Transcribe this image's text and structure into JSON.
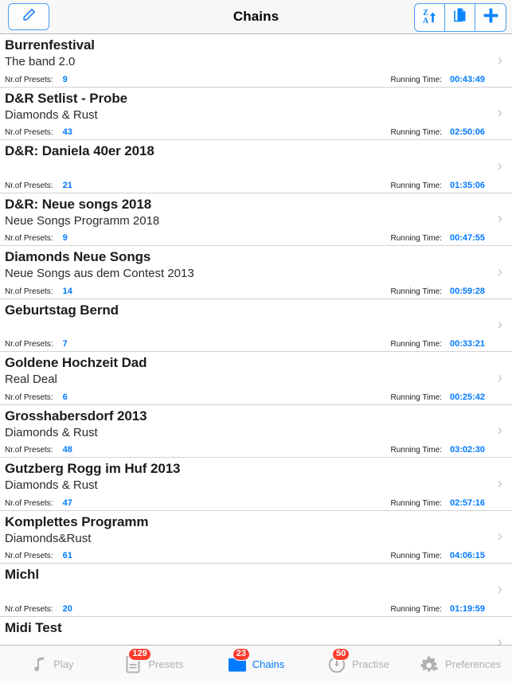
{
  "navbar": {
    "title": "Chains",
    "edit_icon": "pencil-icon",
    "sort_letters_top": "Z",
    "sort_letters_bottom": "A",
    "sort_arrow": "▲",
    "copy_icon": "duplicate-document-icon",
    "add_icon": "plus-icon"
  },
  "list": {
    "presets_label": "Nr.of Presets:",
    "time_label": "Running Time:",
    "rows": [
      {
        "title": "Burrenfestival",
        "subtitle": "The band 2.0",
        "presets": "9",
        "time": "00:43:49"
      },
      {
        "title": "D&R Setlist - Probe",
        "subtitle": "Diamonds & Rust",
        "presets": "43",
        "time": "02:50:06"
      },
      {
        "title": "D&R: Daniela 40er 2018",
        "subtitle": "",
        "presets": "21",
        "time": "01:35:06"
      },
      {
        "title": "D&R: Neue songs 2018",
        "subtitle": "Neue Songs Programm 2018",
        "presets": "9",
        "time": "00:47:55"
      },
      {
        "title": "Diamonds Neue Songs",
        "subtitle": "Neue Songs aus dem Contest 2013",
        "presets": "14",
        "time": "00:59:28"
      },
      {
        "title": "Geburtstag Bernd",
        "subtitle": "",
        "presets": "7",
        "time": "00:33:21"
      },
      {
        "title": "Goldene Hochzeit Dad",
        "subtitle": "Real Deal",
        "presets": "6",
        "time": "00:25:42"
      },
      {
        "title": "Grosshabersdorf 2013",
        "subtitle": "Diamonds & Rust",
        "presets": "48",
        "time": "03:02:30"
      },
      {
        "title": "Gutzberg Rogg im Huf 2013",
        "subtitle": "Diamonds & Rust",
        "presets": "47",
        "time": "02:57:16"
      },
      {
        "title": "Komplettes Programm",
        "subtitle": "Diamonds&Rust",
        "presets": "61",
        "time": "04:06:15"
      },
      {
        "title": "Michl",
        "subtitle": "",
        "presets": "20",
        "time": "01:19:59"
      },
      {
        "title": "Midi Test",
        "subtitle": "",
        "presets": "",
        "time": ""
      }
    ]
  },
  "tabbar": {
    "tabs": [
      {
        "label": "Play",
        "icon": "music-note-icon",
        "badge": "",
        "selected": false
      },
      {
        "label": "Presets",
        "icon": "document-icon",
        "badge": "129",
        "selected": false
      },
      {
        "label": "Chains",
        "icon": "folder-icon",
        "badge": "23",
        "selected": true
      },
      {
        "label": "Practise",
        "icon": "metronome-icon",
        "badge": "50",
        "selected": false
      },
      {
        "label": "Preferences",
        "icon": "gears-icon",
        "badge": "",
        "selected": false
      }
    ]
  },
  "colors": {
    "accent": "#007aff",
    "badge": "#fa3c2d",
    "inactive": "#b0b0b0"
  }
}
